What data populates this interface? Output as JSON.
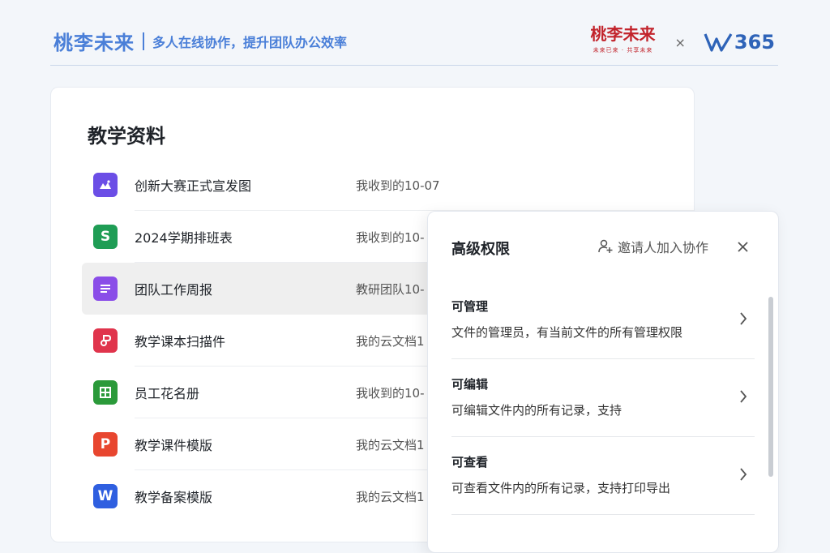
{
  "header": {
    "brand_name": "桃李未来",
    "slogan": "多人在线协作，提升团队办公效率",
    "partner_logo": "桃李未来",
    "partner_sub": "未来已来 · 共享未来",
    "partner_x": "×",
    "wps_suffix": "365"
  },
  "doc_list": {
    "title": "教学资料",
    "files": [
      {
        "name": "创新大赛正式宣发图",
        "meta": "我收到的10-07",
        "icon": "image-icon",
        "color": "#6b4ee6",
        "glyph": "◭"
      },
      {
        "name": "2024学期排班表",
        "meta": "我收到的10-",
        "icon": "spreadsheet-icon",
        "color": "#1f9d55",
        "glyph": "S"
      },
      {
        "name": "团队工作周报",
        "meta": "教研团队10-",
        "icon": "document-icon",
        "color": "#8a4de8",
        "glyph": "≡"
      },
      {
        "name": "教学课本扫描件",
        "meta": "我的云文档1",
        "icon": "pdf-icon",
        "color": "#e0344c",
        "glyph": "P"
      },
      {
        "name": "员工花名册",
        "meta": "我收到的10-",
        "icon": "table-icon",
        "color": "#2b9a3a",
        "glyph": "▦"
      },
      {
        "name": "教学课件模版",
        "meta": "我的云文档1",
        "icon": "presentation-icon",
        "color": "#e8462f",
        "glyph": "P"
      },
      {
        "name": "教学备案模版",
        "meta": "我的云文档1",
        "icon": "word-icon",
        "color": "#2f5fe0",
        "glyph": "W"
      }
    ]
  },
  "permissions": {
    "title": "高级权限",
    "invite_label": "邀请人加入协作",
    "items": [
      {
        "name": "可管理",
        "desc": "文件的管理员，有当前文件的所有管理权限"
      },
      {
        "name": "可编辑",
        "desc": "可编辑文件内的所有记录，支持"
      },
      {
        "name": "可查看",
        "desc": "可查看文件内的所有记录，支持打印导出"
      }
    ]
  },
  "colors": {
    "brand_blue": "#4a7fd8",
    "partner_red": "#c2232b",
    "selected_row": "#efefef"
  }
}
